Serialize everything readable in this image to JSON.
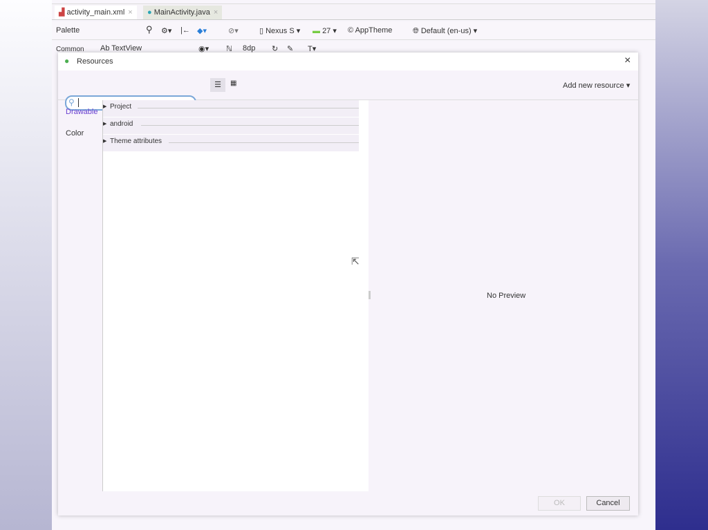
{
  "editor_tabs": [
    {
      "label": "activity_main.xml",
      "active": true
    },
    {
      "label": "MainActivity.java",
      "active": false
    }
  ],
  "palette": {
    "title": "Palette",
    "category": "Common",
    "item": "Ab TextView"
  },
  "toolbar": {
    "device": "Nexus S",
    "api": "27",
    "theme": "AppTheme",
    "locale": "Default (en-us)",
    "margin": "8dp"
  },
  "dialog": {
    "title": "Resources",
    "search_value": "",
    "add_new_resource": "Add new resource",
    "nav": [
      {
        "label": "Drawable",
        "selected": true
      },
      {
        "label": "Color",
        "selected": false
      }
    ],
    "groups": [
      "Project",
      "android",
      "Theme attributes"
    ],
    "preview_text": "No Preview",
    "ok_label": "OK",
    "cancel_label": "Cancel"
  },
  "colors": {
    "accent": "#6a3fd0",
    "search_border": "#7aa7d8",
    "right_band": "#2e2e8e"
  }
}
